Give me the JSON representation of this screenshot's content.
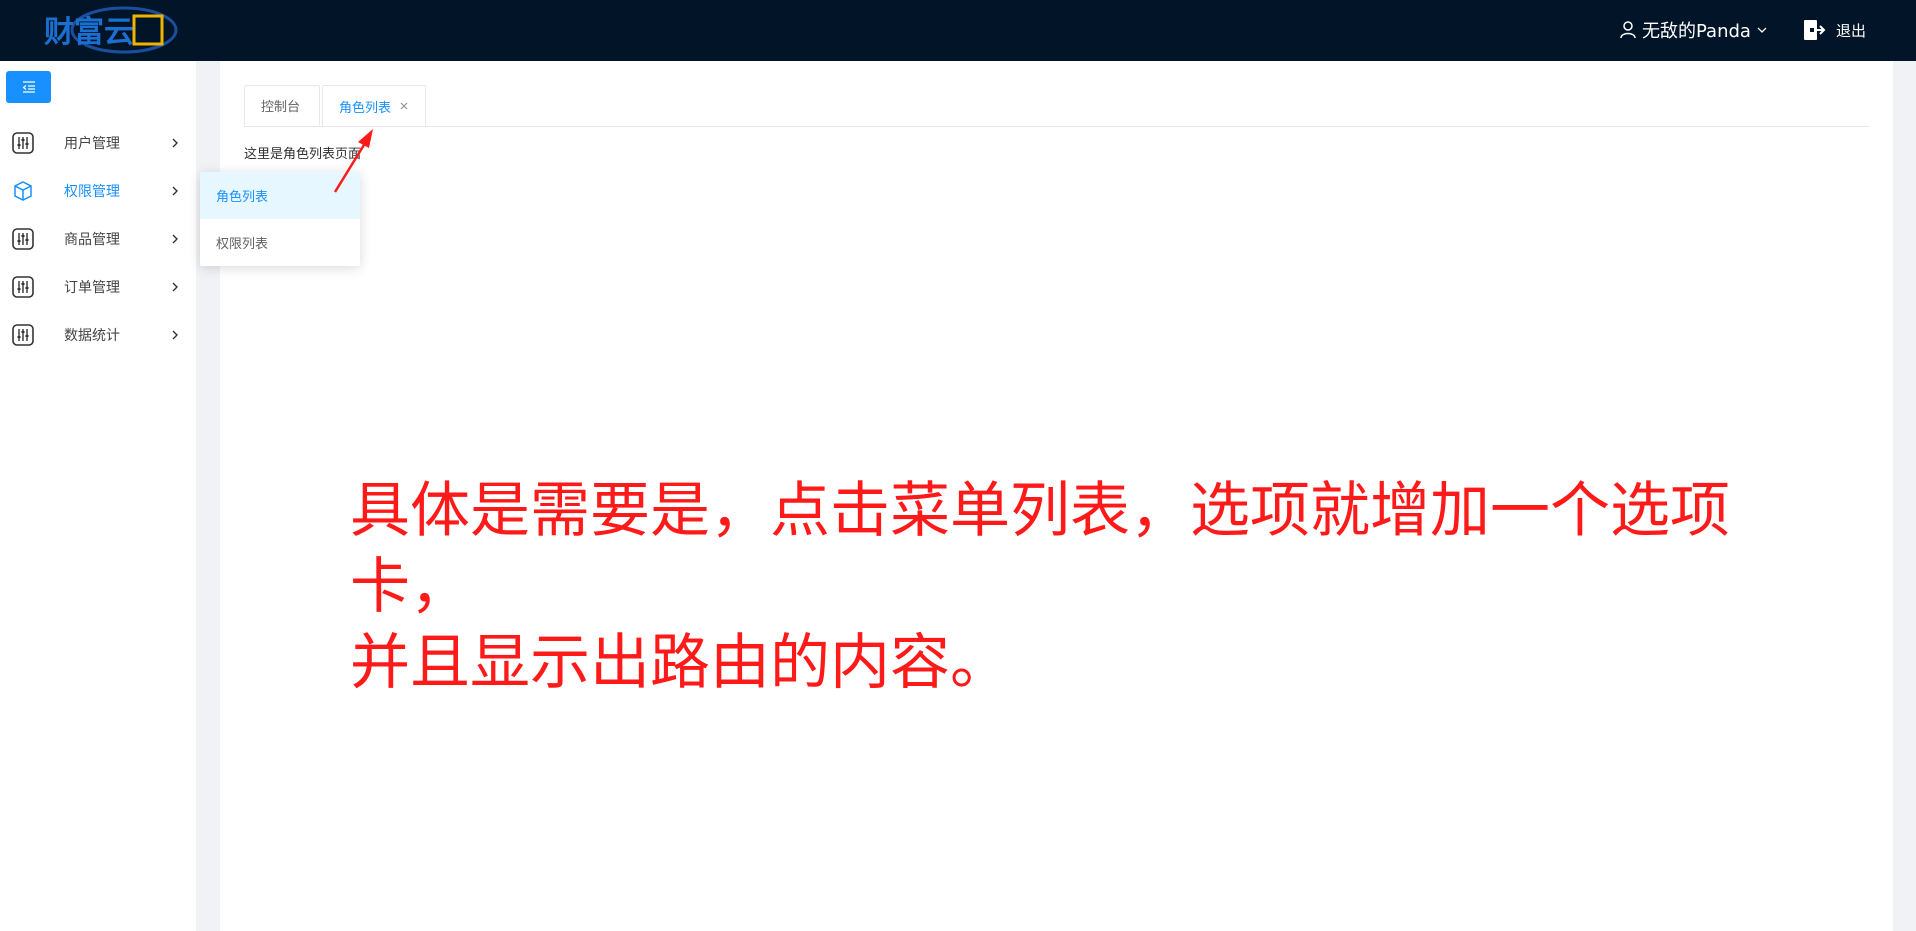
{
  "header": {
    "logo_text": "财富云",
    "user_name": "无敌的Panda",
    "logout_label": "退出"
  },
  "sidebar": {
    "items": [
      {
        "label": "用户管理",
        "icon": "sliders-icon"
      },
      {
        "label": "权限管理",
        "icon": "cube-icon",
        "active": true
      },
      {
        "label": "商品管理",
        "icon": "sliders-icon"
      },
      {
        "label": "订单管理",
        "icon": "sliders-icon"
      },
      {
        "label": "数据统计",
        "icon": "sliders-icon"
      }
    ],
    "submenu": [
      {
        "label": "角色列表",
        "active": true
      },
      {
        "label": "权限列表"
      }
    ]
  },
  "tabs": [
    {
      "label": "控制台"
    },
    {
      "label": "角色列表",
      "active": true,
      "closable": true
    }
  ],
  "page": {
    "body_text": "这里是角色列表页面"
  },
  "annotation": {
    "line1": "具体是需要是，点击菜单列表，选项就增加一个选项卡，",
    "line2": "并且显示出路由的内容。"
  },
  "colors": {
    "header_bg": "#021428",
    "accent": "#1890ff",
    "submenu_active_bg": "#e6f7ff",
    "annotation": "#ff1a1a",
    "gutter": "#f0f2f5"
  }
}
